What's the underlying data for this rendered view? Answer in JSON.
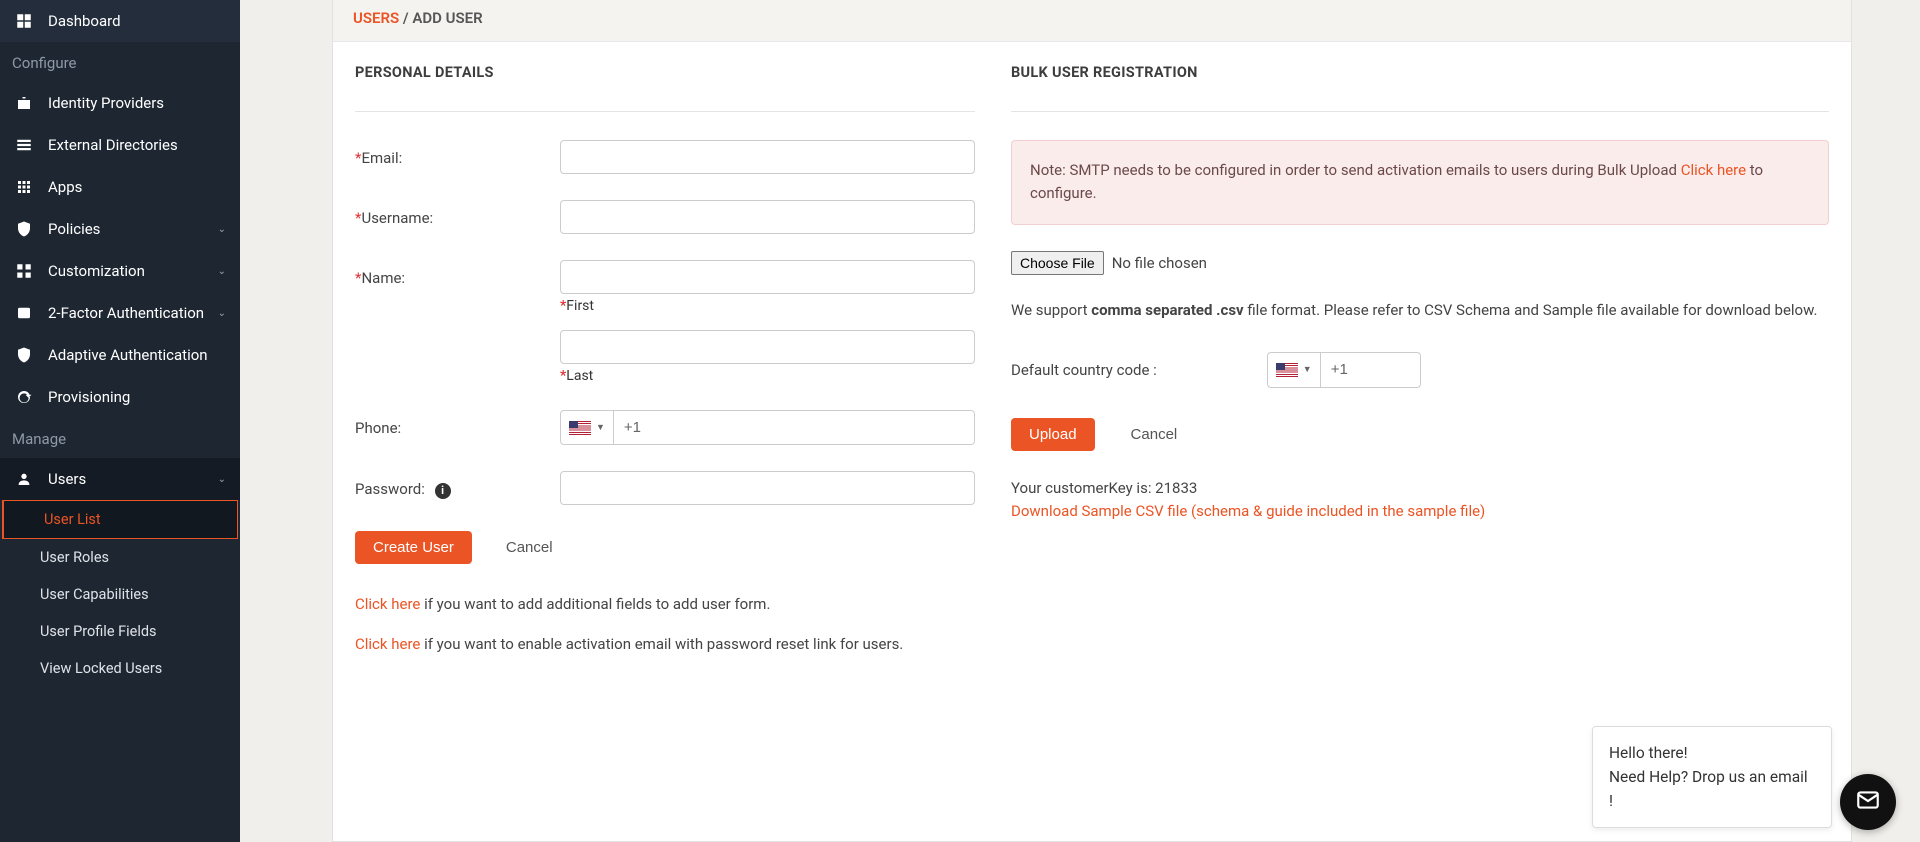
{
  "sidebar": {
    "dashboard": "Dashboard",
    "configure": "Configure",
    "identity_providers": "Identity Providers",
    "external_directories": "External Directories",
    "apps": "Apps",
    "policies": "Policies",
    "customization": "Customization",
    "two_factor": "2-Factor Authentication",
    "adaptive_auth": "Adaptive Authentication",
    "provisioning": "Provisioning",
    "manage": "Manage",
    "users": "Users",
    "user_list": "User List",
    "user_roles": "User Roles",
    "user_capabilities": "User Capabilities",
    "user_profile_fields": "User Profile Fields",
    "view_locked_users": "View Locked Users"
  },
  "breadcrumb": {
    "users": "USERS",
    "sep": " / ",
    "current": "ADD USER"
  },
  "form": {
    "section_title": "PERSONAL DETAILS",
    "email_label": "Email:",
    "username_label": "Username:",
    "name_label": "Name:",
    "first_hint": "First",
    "last_hint": "Last",
    "phone_label": "Phone:",
    "phone_prefix": "+1",
    "password_label": "Password:",
    "create_btn": "Create User",
    "cancel_btn": "Cancel",
    "link_text": "Click here",
    "helper1_rest": " if you want to add additional fields to add user form.",
    "helper2_rest": " if you want to enable activation email with password reset link for users."
  },
  "bulk": {
    "section_title": "BULK USER REGISTRATION",
    "note_pre": "Note: SMTP needs to be configured in order to send activation emails to users during Bulk Upload ",
    "note_link": "Click here",
    "note_post": " to configure.",
    "choose_file": "Choose File",
    "no_file": "No file chosen",
    "support_pre": "We support ",
    "support_bold": "comma separated .csv",
    "support_post": " file format. Please refer to CSV Schema and Sample file available for download below.",
    "cc_label": "Default country code :",
    "cc_value": "+1",
    "upload_btn": "Upload",
    "cancel_btn": "Cancel",
    "key_line": "Your customerKey is: 21833",
    "download_link": "Download Sample CSV file (schema & guide included in the sample file)"
  },
  "chat": {
    "line1": "Hello there!",
    "line2": "Need Help? Drop us an email !"
  }
}
